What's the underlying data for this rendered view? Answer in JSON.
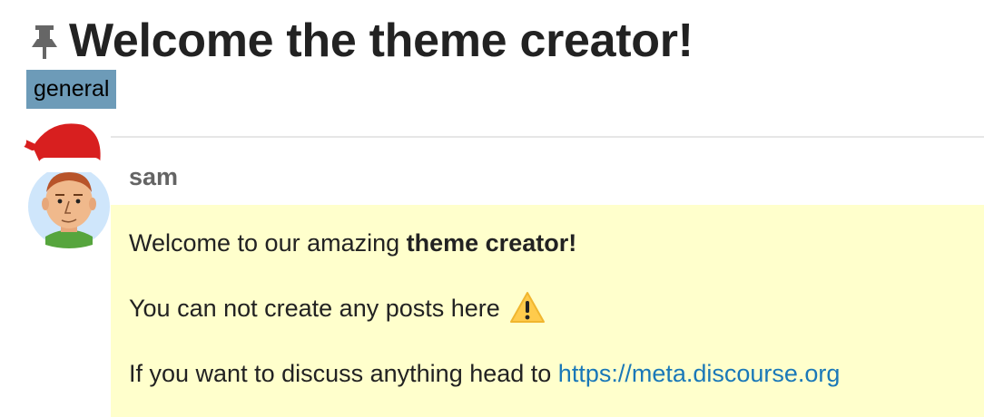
{
  "topic": {
    "title": "Welcome the theme creator!",
    "category": "general",
    "pin_icon": "pin-icon"
  },
  "post": {
    "author": "sam",
    "avatar_icon": "avatar-with-santa-hat",
    "paragraphs": {
      "p1_text": "Welcome to our amazing ",
      "p1_bold": "theme creator!",
      "p2_text": "You can not create any posts here",
      "p2_icon": "warning-icon",
      "p3_text": "If you want to discuss anything head to ",
      "p3_link": "https://meta.discourse.org"
    }
  },
  "colors": {
    "category_badge": "#6d9bb8",
    "post_highlight": "#ffffcc",
    "link": "#1a78b8",
    "username": "#646464"
  }
}
